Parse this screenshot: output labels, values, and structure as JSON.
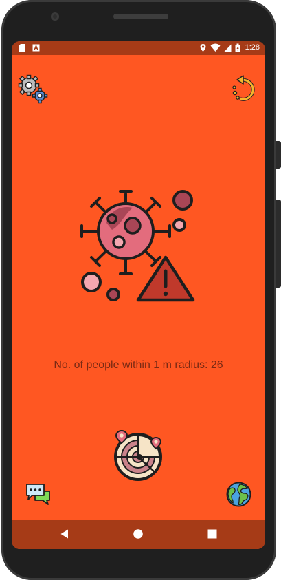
{
  "status_bar": {
    "time": "1:28",
    "left_icons": [
      "sd-card-icon",
      "a-notification-icon"
    ],
    "right_icons": [
      "location-icon",
      "wifi-icon",
      "signal-icon",
      "battery-icon"
    ]
  },
  "top_bar": {
    "settings_icon": "gears-icon",
    "refresh_icon": "refresh-icon"
  },
  "main": {
    "illustration": "virus-warning-icon",
    "message": "No. of people within 1 m radius: 26"
  },
  "bottom": {
    "radar_icon": "radar-icon",
    "chat_icon": "chat-icon",
    "globe_icon": "globe-icon"
  },
  "colors": {
    "background": "#ff5722",
    "bars": "#a63b17",
    "text": "#7a2a14"
  }
}
